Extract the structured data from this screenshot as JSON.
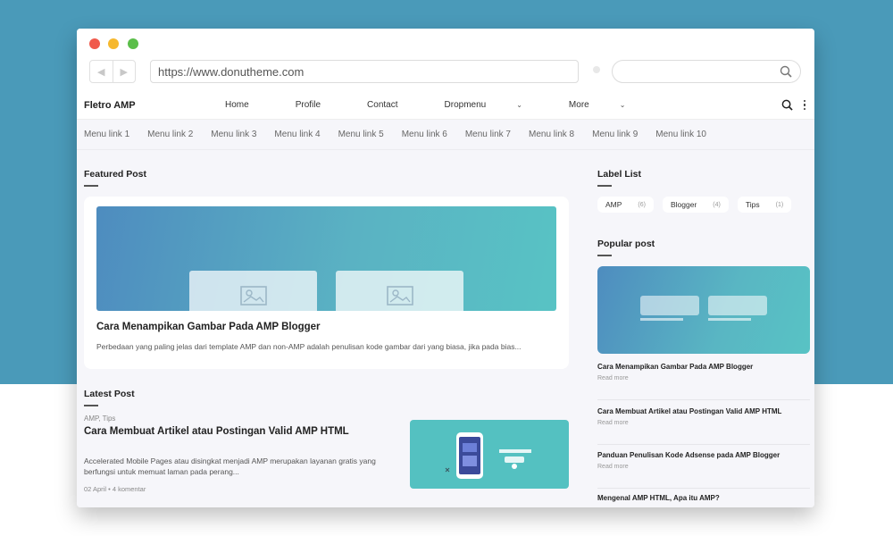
{
  "browser": {
    "url": "https://www.donutheme.com",
    "back_icon": "chevron-left-icon",
    "forward_icon": "chevron-right-icon",
    "search_icon": "search-icon"
  },
  "site": {
    "brand": "Fletro AMP",
    "menu": [
      "Home",
      "Profile",
      "Contact",
      "Dropmenu",
      "More"
    ],
    "menu_links": [
      "Menu link 1",
      "Menu link 2",
      "Menu link 3",
      "Menu link 4",
      "Menu link 5",
      "Menu link 6",
      "Menu link 7",
      "Menu link 8",
      "Menu link 9",
      "Menu link 10"
    ]
  },
  "featured": {
    "heading": "Featured Post",
    "title": "Cara Menampikan Gambar Pada AMP Blogger",
    "description": "Perbedaan yang paling jelas dari template AMP dan non-AMP adalah penulisan kode gambar dari yang biasa, jika pada bias..."
  },
  "latest": {
    "heading": "Latest Post",
    "labels": "AMP, Tips",
    "title": "Cara Membuat Artikel atau Postingan Valid AMP HTML",
    "description": "Accelerated Mobile Pages atau disingkat menjadi AMP merupakan layanan gratis yang berfungsi untuk memuat laman pada perang...",
    "date": "02 April",
    "comments": "4 komentar"
  },
  "sidebar": {
    "label_heading": "Label List",
    "labels": [
      {
        "name": "AMP",
        "count": "(6)"
      },
      {
        "name": "Blogger",
        "count": "(4)"
      },
      {
        "name": "Tips",
        "count": "(1)"
      }
    ],
    "popular_heading": "Popular post",
    "read_more": "Read more",
    "popular": [
      "Cara Menampikan Gambar Pada AMP Blogger",
      "Cara Membuat Artikel atau Postingan Valid AMP HTML",
      "Panduan Penulisan Kode Adsense pada AMP Blogger",
      "Mengenal AMP HTML, Apa itu AMP?"
    ]
  },
  "colors": {
    "background_top": "#4a9ab9",
    "accent_teal": "#58c3c4",
    "accent_blue": "#4e8cbf"
  }
}
